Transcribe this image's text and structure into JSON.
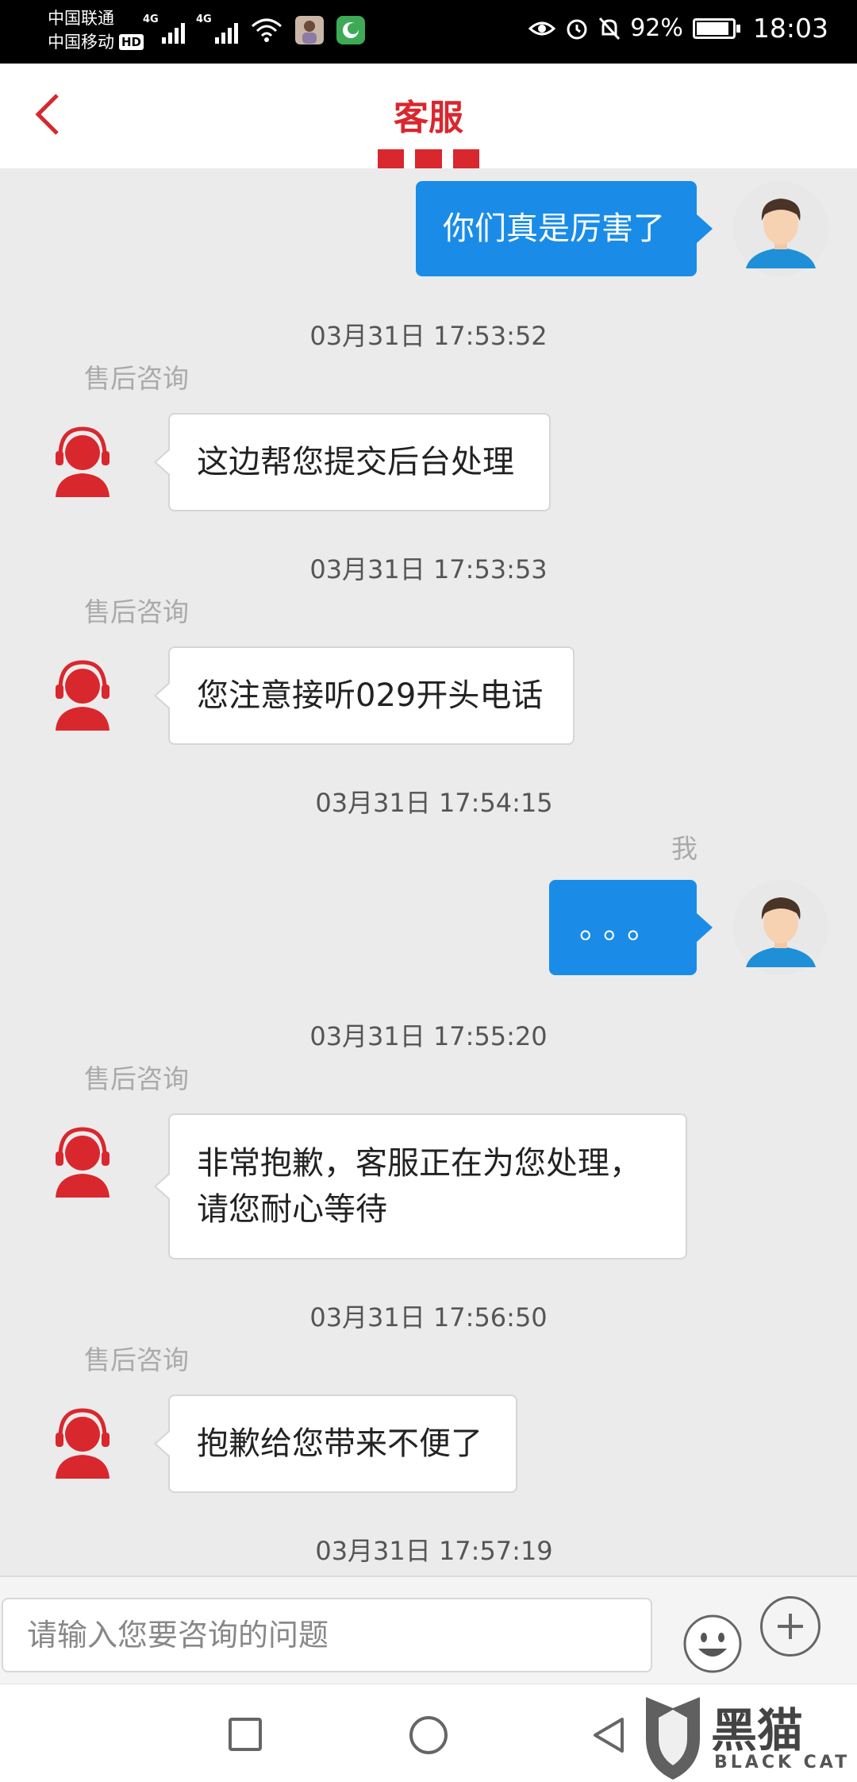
{
  "status_bar": {
    "carrier_1": "中国联通",
    "carrier_2": "中国移动",
    "hd_badge": "HD",
    "network_1": "4G",
    "network_2": "4G",
    "battery_text": "92%",
    "battery_level": 0.92,
    "time": "18:03"
  },
  "header": {
    "title": "客服",
    "accent_color": "#d9272e"
  },
  "chat": {
    "messages": [
      {
        "side": "right",
        "sender": "",
        "timestamp": "",
        "text": "你们真是厉害了"
      },
      {
        "side": "left",
        "timestamp": "03月31日 17:53:52",
        "sender": "售后咨询",
        "text": "这边帮您提交后台处理"
      },
      {
        "side": "left",
        "timestamp": "03月31日 17:53:53",
        "sender": "售后咨询",
        "text": "您注意接听029开头电话"
      },
      {
        "side": "right",
        "timestamp": "03月31日 17:54:15",
        "sender": "我",
        "text": "。。。"
      },
      {
        "side": "left",
        "timestamp": "03月31日 17:55:20",
        "sender": "售后咨询",
        "text_line_1": "非常抱歉，客服正在为您处理，",
        "text_line_2": "请您耐心等待"
      },
      {
        "side": "left",
        "timestamp": "03月31日 17:56:50",
        "sender": "售后咨询",
        "text": "抱歉给您带来不便了"
      },
      {
        "side": "",
        "timestamp": "03月31日 17:57:19",
        "sender": "",
        "text": ""
      }
    ],
    "user_bubble_color": "#1a8ce8"
  },
  "input_bar": {
    "placeholder": "请输入您要咨询的问题",
    "emoji_icon": "smiley-icon",
    "plus_icon": "plus-icon"
  },
  "nav_bar": {
    "recent_icon": "square-icon",
    "home_icon": "circle-icon",
    "back_icon": "triangle-back-icon",
    "watermark_logo": "黑猫",
    "watermark_text": "BLACK CAT"
  }
}
